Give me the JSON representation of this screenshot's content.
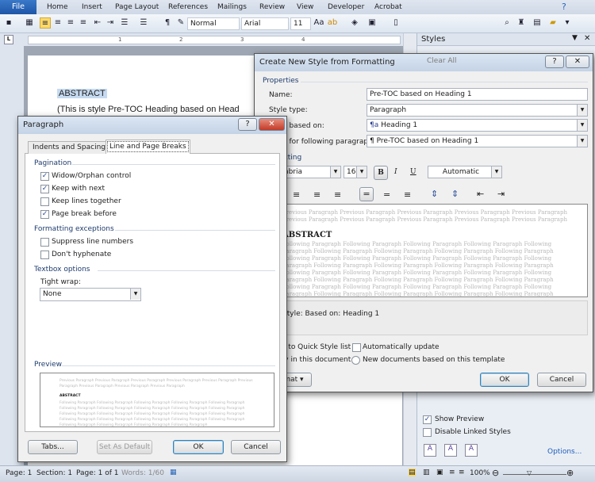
{
  "ribbon": {
    "tabs": [
      "File",
      "Home",
      "Insert",
      "Page Layout",
      "References",
      "Mailings",
      "Review",
      "View",
      "Developer",
      "Acrobat"
    ],
    "style_combo": "Normal",
    "font_combo": "Arial",
    "size_combo": "11"
  },
  "ruler": {
    "marks": [
      "1",
      "2",
      "3",
      "4"
    ]
  },
  "document": {
    "line1": "ABSTRACT",
    "line2": "(This is style Pre-TOC Heading based on Head"
  },
  "styles_pane": {
    "title": "Styles",
    "clear_all": "Clear All",
    "show_preview": "Show Preview",
    "show_preview_checked": true,
    "disable_linked": "Disable Linked Styles",
    "disable_linked_checked": false,
    "options": "Options..."
  },
  "create_style": {
    "title": "Create New Style from Formatting",
    "properties": "Properties",
    "name_label": "Name:",
    "name_value": "Pre-TOC based on Heading 1",
    "type_label": "Style type:",
    "type_value": "Paragraph",
    "based_label": "Style based on:",
    "based_value": "Heading 1",
    "following_label": "Style for following paragraph:",
    "following_value": "Pre-TOC based on Heading 1",
    "formatting": "Formatting",
    "font_value": "Cambria",
    "size_value": "16",
    "bold": "B",
    "italic": "I",
    "underline": "U",
    "color_value": "Automatic",
    "preview_previous": "Previous Paragraph Previous Paragraph Previous Paragraph Previous Paragraph Previous Paragraph Previous Paragraph Previous Paragraph Previous Paragraph Previous Paragraph Previous Paragraph",
    "preview_heading": "ABSTRACT",
    "preview_following": "Following Paragraph Following Paragraph Following Paragraph Following Paragraph Following Paragraph Following Paragraph Following Paragraph Following Paragraph Following Paragraph Following Paragraph Following Paragraph Following Paragraph Following Paragraph Following Paragraph Following Paragraph Following Paragraph Following Paragraph Following Paragraph Following Paragraph Following Paragraph Following Paragraph Following Paragraph Following Paragraph Following Paragraph Following Paragraph Following Paragraph Following Paragraph Following Paragraph Following Paragraph Following Paragraph Following Paragraph Following Paragraph Following Paragraph Following Paragraph Following Paragraph Following Paragraph Following Paragraph Following Paragraph",
    "description": "Style: Based on: Heading 1",
    "add_quick": "Add to Quick Style list",
    "auto_update": "Automatically update",
    "auto_update_checked": false,
    "only_doc": "Only in this document",
    "new_docs": "New documents based on this template",
    "format_btn": "Format",
    "ok": "OK",
    "cancel": "Cancel"
  },
  "paragraph": {
    "title": "Paragraph",
    "tabs": [
      "Indents and Spacing",
      "Line and Page Breaks"
    ],
    "active_tab": "Line and Page Breaks",
    "pagination": "Pagination",
    "options": [
      {
        "label": "Widow/Orphan control",
        "checked": true
      },
      {
        "label": "Keep with next",
        "checked": true
      },
      {
        "label": "Keep lines together",
        "checked": false
      },
      {
        "label": "Page break before",
        "checked": true
      }
    ],
    "formatting_exceptions": "Formatting exceptions",
    "exceptions": [
      {
        "label": "Suppress line numbers",
        "checked": false
      },
      {
        "label": "Don't hyphenate",
        "checked": false
      }
    ],
    "textbox": "Textbox options",
    "tight_wrap_label": "Tight wrap:",
    "tight_wrap_value": "None",
    "preview": "Preview",
    "preview_heading": "ABSTRACT",
    "preview_previous": "Previous Paragraph Previous Paragraph Previous Paragraph Previous Paragraph Previous Paragraph Previous Paragraph Previous Paragraph Previous Paragraph Previous Paragraph",
    "preview_following": "Following Paragraph Following Paragraph Following Paragraph Following Paragraph Following Paragraph Following Paragraph Following Paragraph Following Paragraph Following Paragraph Following Paragraph Following Paragraph Following Paragraph Following Paragraph Following Paragraph Following Paragraph Following Paragraph Following Paragraph Following Paragraph Following Paragraph Following Paragraph Following Paragraph Following Paragraph Following Paragraph Following Paragraph",
    "tabs_btn": "Tabs...",
    "default_btn": "Set As Default",
    "ok": "OK",
    "cancel": "Cancel"
  },
  "status": {
    "page": "Page: 1",
    "section": "Section: 1",
    "pages": "Page: 1 of 1",
    "words": "Words: 1/60",
    "zoom": "100%"
  },
  "colors": {
    "file_tab": "#2a66b8",
    "highlight": "#c5daf0",
    "accent": "#3c7fb1"
  }
}
